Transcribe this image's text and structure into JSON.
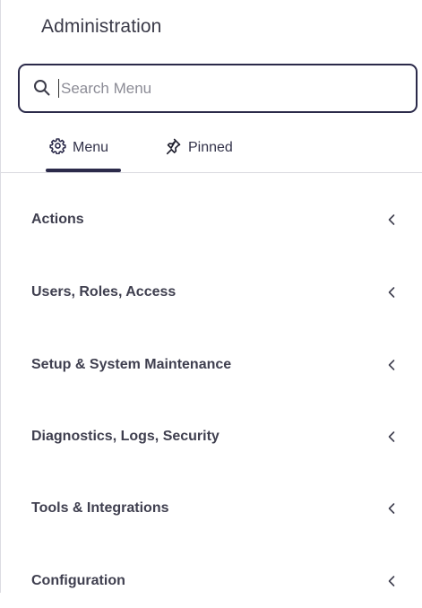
{
  "header": {
    "title": "Administration"
  },
  "search": {
    "placeholder": "Search Menu",
    "value": "",
    "icon": "search-icon"
  },
  "tabs": [
    {
      "label": "Menu",
      "icon": "gear-icon",
      "active": true
    },
    {
      "label": "Pinned",
      "icon": "pin-icon",
      "active": false
    }
  ],
  "menu": {
    "items": [
      {
        "label": "Actions",
        "icon": "chevron-left-icon"
      },
      {
        "label": "Users, Roles, Access",
        "icon": "chevron-left-icon"
      },
      {
        "label": "Setup & System Maintenance",
        "icon": "chevron-left-icon"
      },
      {
        "label": "Diagnostics, Logs, Security",
        "icon": "chevron-left-icon"
      },
      {
        "label": "Tools & Integrations",
        "icon": "chevron-left-icon"
      },
      {
        "label": "Configuration",
        "icon": "chevron-left-icon"
      }
    ]
  },
  "colors": {
    "accent": "#2b2a4a",
    "text": "#3f3f4f",
    "border": "#dadae0"
  }
}
